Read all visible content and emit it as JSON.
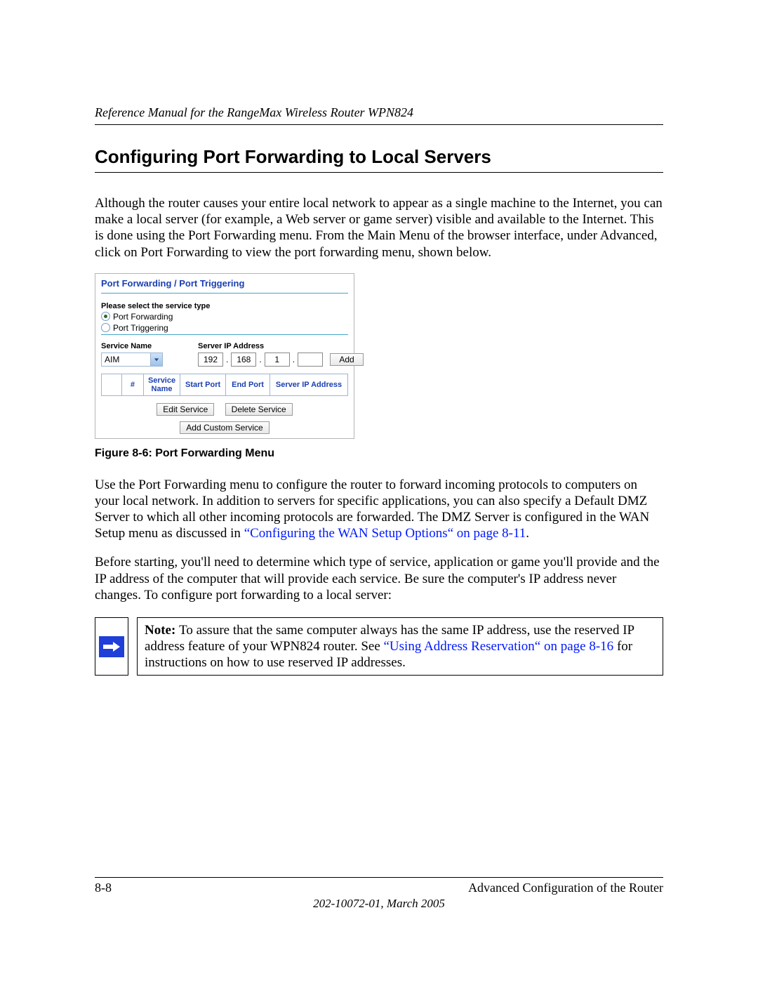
{
  "header": {
    "running_head": "Reference Manual for the RangeMax Wireless Router WPN824"
  },
  "section": {
    "title": "Configuring Port Forwarding to Local Servers",
    "para1": "Although the router causes your entire local network to appear as a single machine to the Internet, you can make a local server (for example, a Web server or game server) visible and available to the Internet. This is done using the Port Forwarding menu. From the Main Menu of the browser interface, under Advanced, click on Port Forwarding to view the port forwarding menu, shown below."
  },
  "figure": {
    "caption": "Figure 8-6:  Port Forwarding Menu",
    "ui": {
      "title": "Port Forwarding / Port Triggering",
      "prompt": "Please select the service type",
      "radios": [
        {
          "label": "Port Forwarding",
          "checked": true
        },
        {
          "label": "Port Triggering",
          "checked": false
        }
      ],
      "svc_label": "Service Name",
      "ip_label": "Server IP Address",
      "service_selected": "AIM",
      "ip": {
        "o1": "192",
        "o2": "168",
        "o3": "1",
        "o4": ""
      },
      "add_btn": "Add",
      "table": {
        "cols": [
          "#",
          "Service Name",
          "Start Port",
          "End Port",
          "Server IP Address"
        ]
      },
      "buttons": {
        "edit": "Edit Service",
        "delete": "Delete Service",
        "custom": "Add Custom Service"
      }
    }
  },
  "body": {
    "para2_a": "Use the Port Forwarding menu to configure the router to forward incoming protocols to computers on your local network. In addition to servers for specific applications, you can also specify a Default DMZ Server to which all other incoming protocols are forwarded. The DMZ Server is configured in the WAN Setup menu as discussed in ",
    "para2_linkA": "“Configuring the WAN Setup Options“ on page 8-11",
    "para2_b": ".",
    "para3": "Before starting, you'll need to determine which type of service, application or game you'll provide and the IP address of the computer that will provide each service. Be sure the computer's IP address never changes. To configure port forwarding to a local server:"
  },
  "note": {
    "lead": "Note: ",
    "text_a": "To assure that the same computer always has the same IP address, use the reserved IP address feature of your WPN824 router. See ",
    "link": "“Using Address Reservation“ on page 8-16",
    "text_b": " for instructions on how to use reserved IP addresses."
  },
  "footer": {
    "page": "8-8",
    "right": "Advanced Configuration of the Router",
    "center": "202-10072-01, March 2005"
  }
}
